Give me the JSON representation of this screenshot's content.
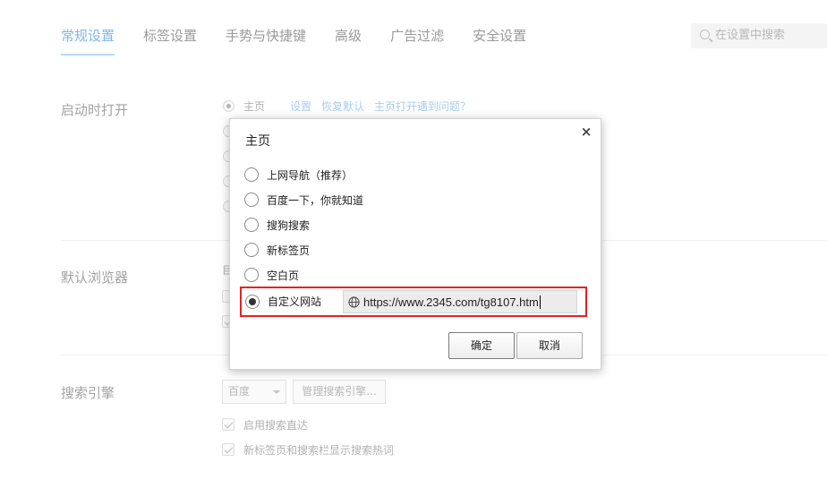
{
  "tabs": [
    {
      "label": "常规设置",
      "active": true
    },
    {
      "label": "标签设置",
      "active": false
    },
    {
      "label": "手势与快捷键",
      "active": false
    },
    {
      "label": "高级",
      "active": false
    },
    {
      "label": "广告过滤",
      "active": false
    },
    {
      "label": "安全设置",
      "active": false
    }
  ],
  "search": {
    "placeholder": "在设置中搜索",
    "icon": "search-icon"
  },
  "startup": {
    "title": "启动时打开",
    "homepage_option": "主页",
    "links": [
      "设置",
      "恢复默认",
      "主页打开遇到问题？"
    ]
  },
  "default_browser": {
    "title": "默认浏览器",
    "visible_fragment": "目"
  },
  "search_engine": {
    "title": "搜索引擎",
    "selected_engine": "百度",
    "manage_button": "管理搜索引擎...",
    "checkboxes": [
      {
        "label": "启用搜索直达",
        "checked": true
      },
      {
        "label": "新标签页和搜索栏显示搜索热词",
        "checked": true
      }
    ]
  },
  "dialog": {
    "title": "主页",
    "close_label": "×",
    "options": [
      {
        "label": "上网导航（推荐）",
        "selected": false
      },
      {
        "label": "百度一下，你就知道",
        "selected": false
      },
      {
        "label": "搜狗搜索",
        "selected": false
      },
      {
        "label": "新标签页",
        "selected": false
      },
      {
        "label": "空白页",
        "selected": false
      }
    ],
    "custom": {
      "label": "自定义网站",
      "selected": true,
      "url": "https://www.2345.com/tg8107.htm"
    },
    "ok_label": "确定",
    "cancel_label": "取消",
    "highlight_color": "#e52222"
  }
}
